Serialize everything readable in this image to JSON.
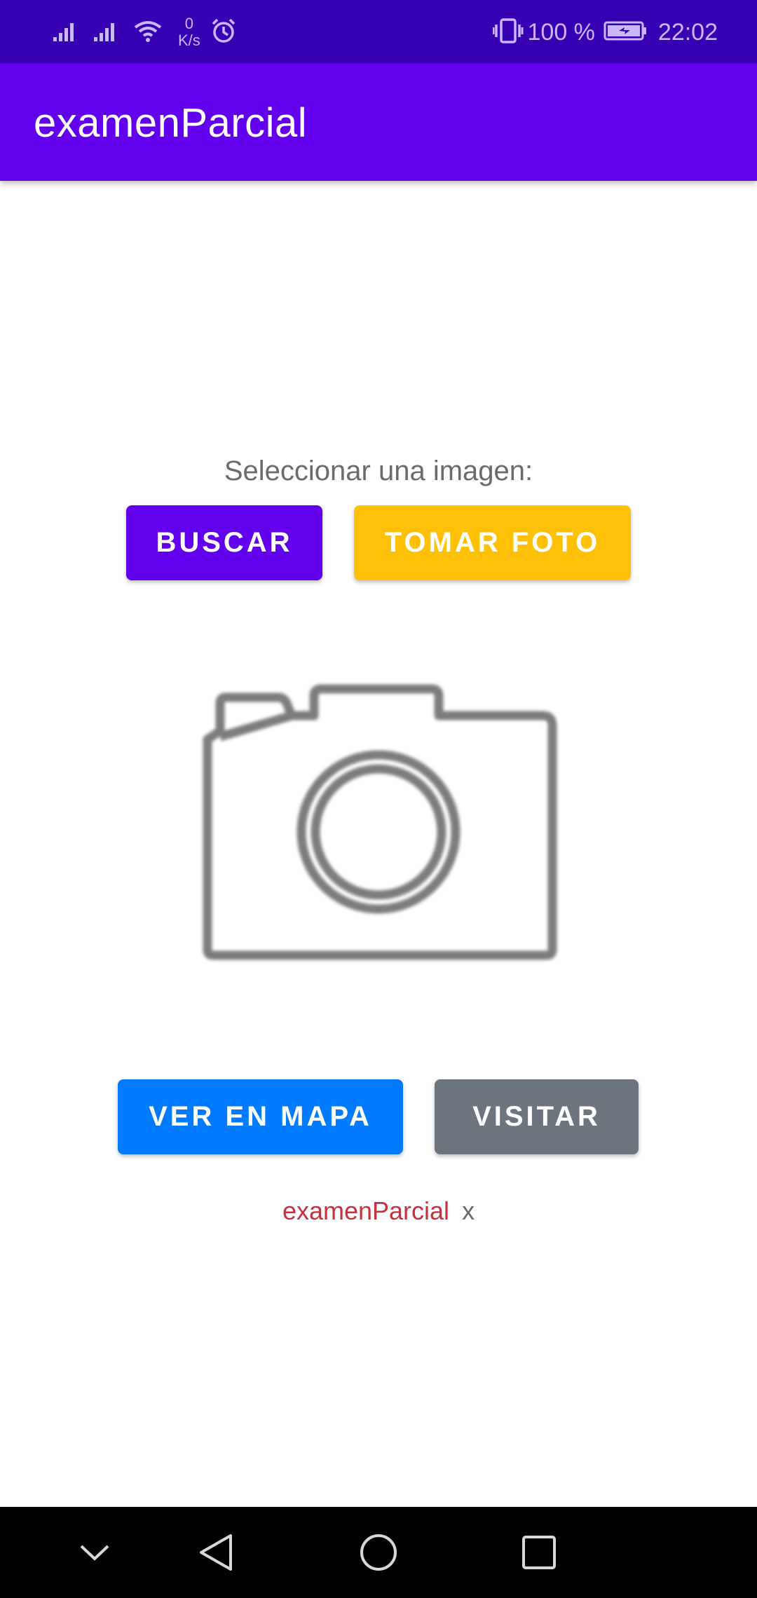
{
  "status_bar": {
    "net_speed_value": "0",
    "net_speed_unit": "K/s",
    "battery_percent": "100 %",
    "time": "22:02",
    "icons": [
      "signal-icon",
      "signal-icon",
      "wifi-icon",
      "alarm-icon",
      "vibrate-icon",
      "battery-icon"
    ]
  },
  "app_bar": {
    "title": "examenParcial"
  },
  "main": {
    "prompt": "Seleccionar una imagen:",
    "buscar_label": "BUSCAR",
    "tomar_foto_label": "TOMAR FOTO",
    "image_placeholder_icon": "camera-icon",
    "ver_en_mapa_label": "VER EN MAPA",
    "visitar_label": "VISITAR",
    "footer_app_name": "examenParcial",
    "footer_x": "x"
  },
  "colors": {
    "status_bar": "#3700b3",
    "app_bar": "#6200ee",
    "buscar": "#6200ee",
    "tomar_foto": "#ffc107",
    "ver_en_mapa": "#007bff",
    "visitar": "#6c757d",
    "footer_app_name": "#c9303c"
  },
  "nav_bar": {
    "icons": [
      "chevron-down-icon",
      "back-icon",
      "home-icon",
      "recents-icon"
    ]
  }
}
